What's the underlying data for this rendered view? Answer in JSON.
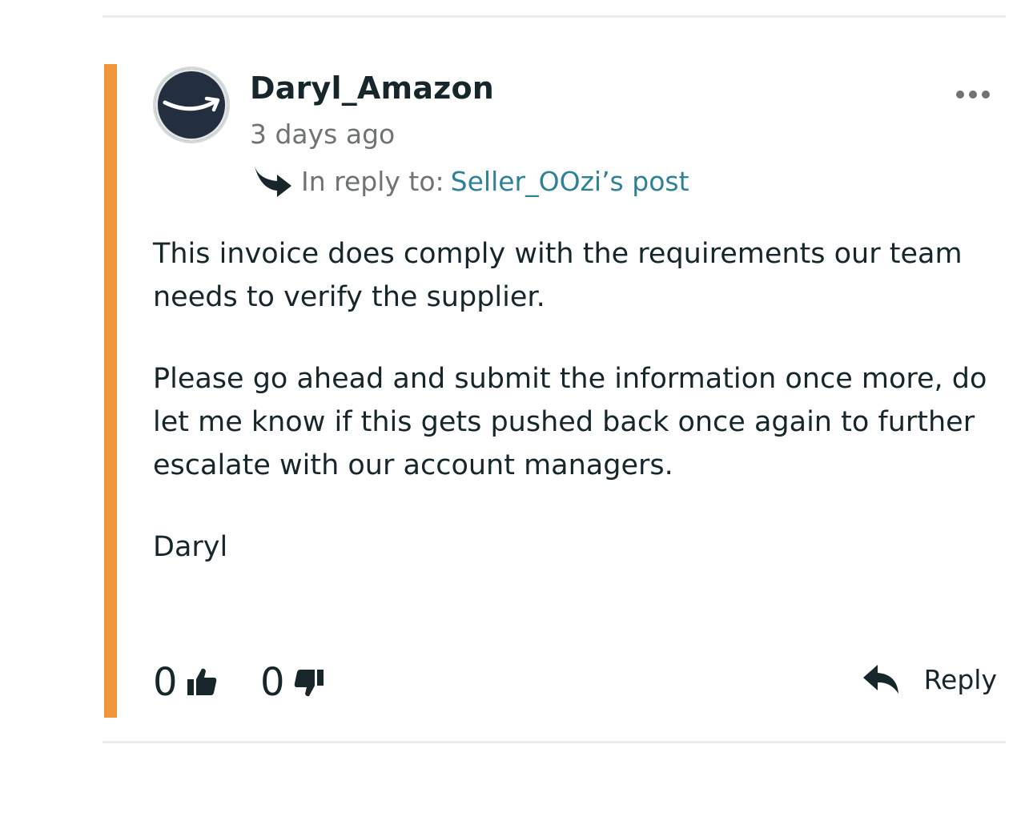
{
  "post": {
    "author": "Daryl_Amazon",
    "timestamp": "3 days ago",
    "reply_to_label": "In reply to:",
    "reply_to_link": "Seller_OOzi’s post",
    "body": [
      "This invoice does comply with the requirements our team needs to verify the supplier.",
      "Please go ahead and submit the information once more, do let me know if this gets pushed back once again to further escalate with our account managers.",
      "Daryl"
    ],
    "upvotes": "0",
    "downvotes": "0",
    "reply_label": "Reply"
  },
  "icons": {
    "avatar": "amazon-smile-logo",
    "menu": "more-options-icon",
    "reply_to": "reply-to-arrow-icon",
    "upvote": "thumbs-up-icon",
    "downvote": "thumbs-down-icon",
    "reply": "reply-arrow-icon"
  },
  "colors": {
    "accent": "#f0953a",
    "link": "#2d8198",
    "text": "#16262b",
    "muted": "#6f7373",
    "avatar_bg": "#232f3e"
  }
}
